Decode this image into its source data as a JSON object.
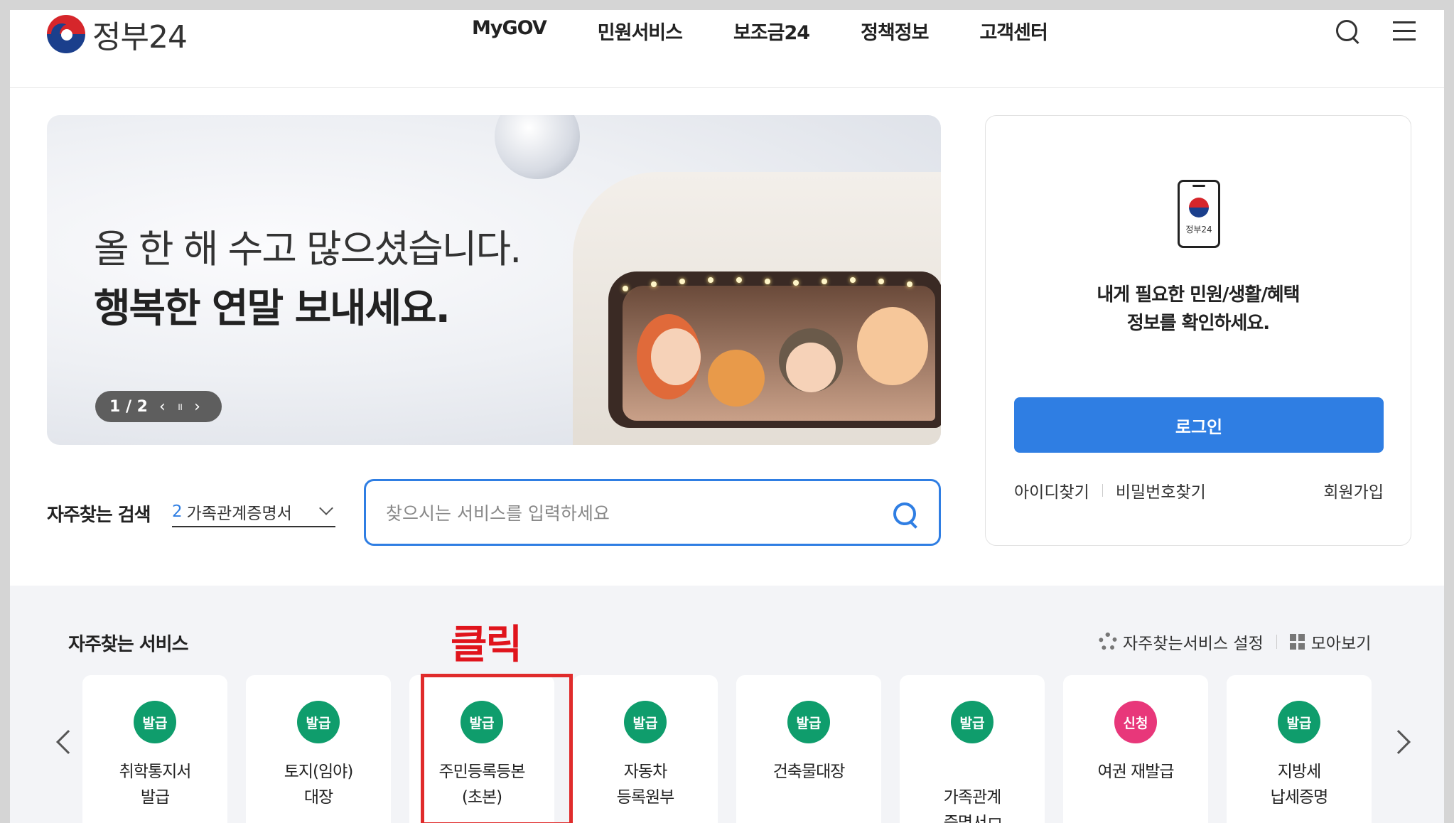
{
  "header": {
    "logo_text": "정부24",
    "nav": [
      "MyGOV",
      "민원서비스",
      "보조금24",
      "정책정보",
      "고객센터"
    ],
    "search_icon": "search-icon",
    "menu_icon": "hamburger-menu-icon"
  },
  "banner": {
    "line1": "올 한 해 수고 많으셨습니다.",
    "line2": "행복한 연말 보내세요.",
    "pager": "1 / 2",
    "prev": "‹",
    "pause": "॥",
    "next": "›"
  },
  "login": {
    "app_label": "정부24",
    "message_line1": "내게 필요한 민원/생활/혜택",
    "message_line2": "정보를 확인하세요.",
    "login_button": "로그인",
    "find_id": "아이디찾기",
    "find_password": "비밀번호찾기",
    "signup": "회원가입"
  },
  "search": {
    "quick_title": "자주찾는 검색",
    "quick_num": "2",
    "quick_value": "가족관계증명서",
    "placeholder": "찾으시는 서비스를 입력하세요"
  },
  "services": {
    "title": "자주찾는 서비스",
    "annotation": "클릭",
    "settings_label": "자주찾는서비스 설정",
    "view_all_label": "모아보기",
    "items": [
      {
        "badge": "발급",
        "label": "취학통지서\n발급"
      },
      {
        "badge": "발급",
        "label": "토지(임야)\n대장"
      },
      {
        "badge": "발급",
        "label": "주민등록등본\n(초본)"
      },
      {
        "badge": "발급",
        "label": "자동차\n등록원부"
      },
      {
        "badge": "발급",
        "label": "건축물대장"
      },
      {
        "badge": "발급",
        "label": "가족관계\n증명서"
      },
      {
        "badge": "신청",
        "label": "여권 재발급"
      },
      {
        "badge": "발급",
        "label": "지방세\n납세증명"
      }
    ]
  },
  "colors": {
    "accent": "#2f7ee3",
    "badge_green": "#0f9d6c",
    "badge_pink": "#e8377a",
    "annotation_red": "#e0141c"
  }
}
